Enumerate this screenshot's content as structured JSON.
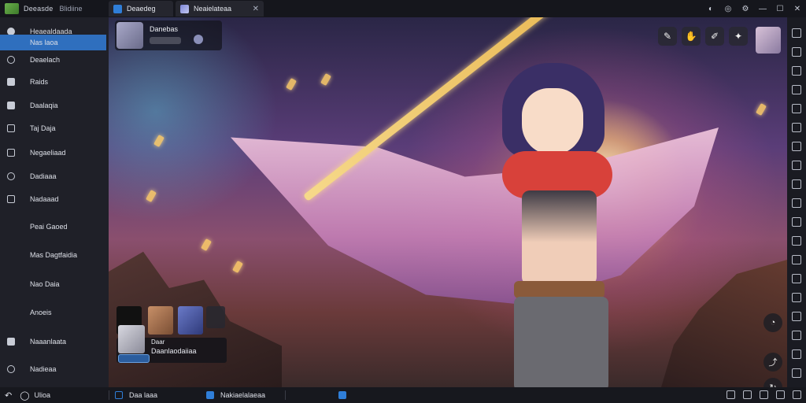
{
  "titlebar": {
    "app_name": "Deeasde",
    "app_sub": "Blidiine",
    "tabs": [
      {
        "label": "Deaedeg"
      },
      {
        "label": "Neaielateaa"
      }
    ]
  },
  "sidebar": {
    "items": [
      {
        "label": "Heaealdaada"
      },
      {
        "label": "Nas laoa"
      },
      {
        "label": "Deaelach"
      },
      {
        "label": "Raids"
      },
      {
        "label": "Daalaqia"
      },
      {
        "label": "Taj Daja"
      },
      {
        "label": "Negaeliaad"
      },
      {
        "label": "Dadiaaa"
      },
      {
        "label": "Nadaaad"
      },
      {
        "label": "Peai Gaoed"
      },
      {
        "label": "Mas Dagtfaidia"
      },
      {
        "label": "Nao Daia"
      },
      {
        "label": "Anoeis"
      },
      {
        "label": "Naaanlaata"
      },
      {
        "label": "Nadieaa"
      }
    ]
  },
  "overlay": {
    "top_left": {
      "title": "Danebas"
    },
    "bottom_left": {
      "line1": "Daar",
      "line2": "Daanlaodaiiaa"
    }
  },
  "taskbar": {
    "start_label": "Ulioa",
    "items": [
      {
        "label": "Daa laaa"
      },
      {
        "label": "Nakiaelalaeaa"
      }
    ]
  },
  "colors": {
    "accent": "#2f6fbe",
    "sidebar_bg": "#1f2028",
    "titlebar_bg": "#15161c",
    "taskbar_bg": "#17181e"
  }
}
